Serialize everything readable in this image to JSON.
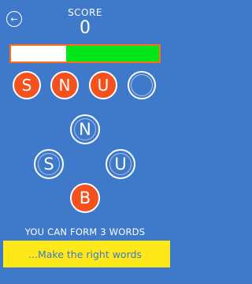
{
  "header": {
    "back_icon": "arrow-left-icon",
    "back_glyph": "←",
    "score_label": "SCORE",
    "score_value": "0"
  },
  "timer": {
    "remaining_fraction": 0.63,
    "bar_color": "#00e61a",
    "border_color": "#ff6b1a"
  },
  "answer_slots": [
    {
      "letter": "S",
      "state": "filled"
    },
    {
      "letter": "N",
      "state": "filled"
    },
    {
      "letter": "U",
      "state": "filled"
    },
    {
      "letter": "",
      "state": "empty"
    }
  ],
  "letter_tiles": [
    {
      "letter": "N",
      "state": "unused"
    },
    {
      "letter": "S",
      "state": "unused"
    },
    {
      "letter": "U",
      "state": "unused"
    },
    {
      "letter": "B",
      "state": "selected"
    }
  ],
  "hint_text": "YOU CAN FORM 3 WORDS",
  "banner_text": "...Make the right words",
  "colors": {
    "background": "#3f79c9",
    "accent": "#f4511e",
    "banner": "#ffe81a"
  }
}
